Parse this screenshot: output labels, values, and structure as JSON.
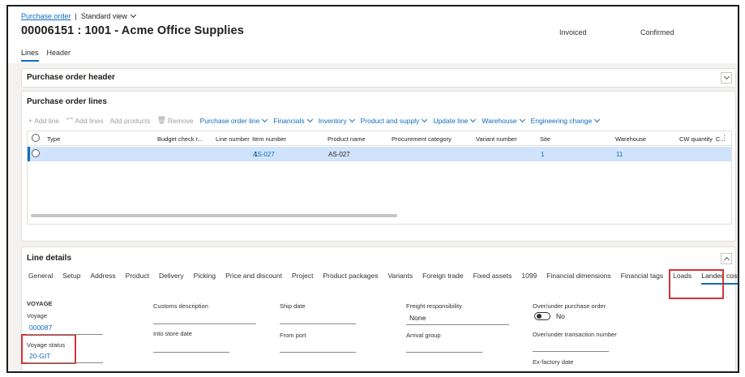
{
  "breadcrumb": {
    "link": "Purchase order",
    "view": "Standard view"
  },
  "title": "00006151 : 1001 - Acme Office Supplies",
  "statuses": [
    "Invoiced",
    "Confirmed"
  ],
  "top_tabs": [
    "Lines",
    "Header"
  ],
  "po_header": {
    "title": "Purchase order header"
  },
  "po_lines": {
    "title": "Purchase order lines",
    "toolbar": {
      "add_line": "Add line",
      "add_lines": "Add lines",
      "add_products": "Add products",
      "remove": "Remove",
      "menus": [
        "Purchase order line",
        "Financials",
        "Inventory",
        "Product and supply",
        "Update line",
        "Warehouse",
        "Engineering change"
      ]
    },
    "columns": [
      "Type",
      "Budget check r...",
      "Line number",
      "Item number",
      "Product name",
      "Procurement category",
      "Variant number",
      "Site",
      "Warehouse",
      "CW quantity",
      "C..."
    ],
    "rows": [
      {
        "line_number": "1",
        "item_number": "AS-027",
        "product_name": "AS-027",
        "site": "1",
        "warehouse": "11"
      }
    ]
  },
  "line_details": {
    "title": "Line details",
    "tabs": [
      "General",
      "Setup",
      "Address",
      "Product",
      "Delivery",
      "Picking",
      "Price and discount",
      "Project",
      "Product packages",
      "Variants",
      "Foreign trade",
      "Fixed assets",
      "1099",
      "Financial dimensions",
      "Financial tags",
      "Loads",
      "Landed cost"
    ],
    "active_tab": "Landed cost",
    "fields": {
      "voyage_group": "VOYAGE",
      "voyage_label": "Voyage",
      "voyage_value": "000087",
      "voyage_status_label": "Voyage status",
      "voyage_status_value": "20-GIT",
      "customs_description_label": "Customs description",
      "into_store_date_label": "Into store date",
      "ship_date_label": "Ship date",
      "from_port_label": "From port",
      "freight_responsibility_label": "Freight responsibility",
      "freight_responsibility_value": "None",
      "arrival_group_label": "Arrival group",
      "over_under_po_label": "Over/under purchase order",
      "over_under_po_value": "No",
      "over_under_transaction_label": "Over/under transaction number",
      "ex_factory_date_label": "Ex-factory date"
    }
  },
  "colors": {
    "accent": "#0f6cbd",
    "highlight": "#d13438",
    "selected_row": "#cfe4fa"
  }
}
